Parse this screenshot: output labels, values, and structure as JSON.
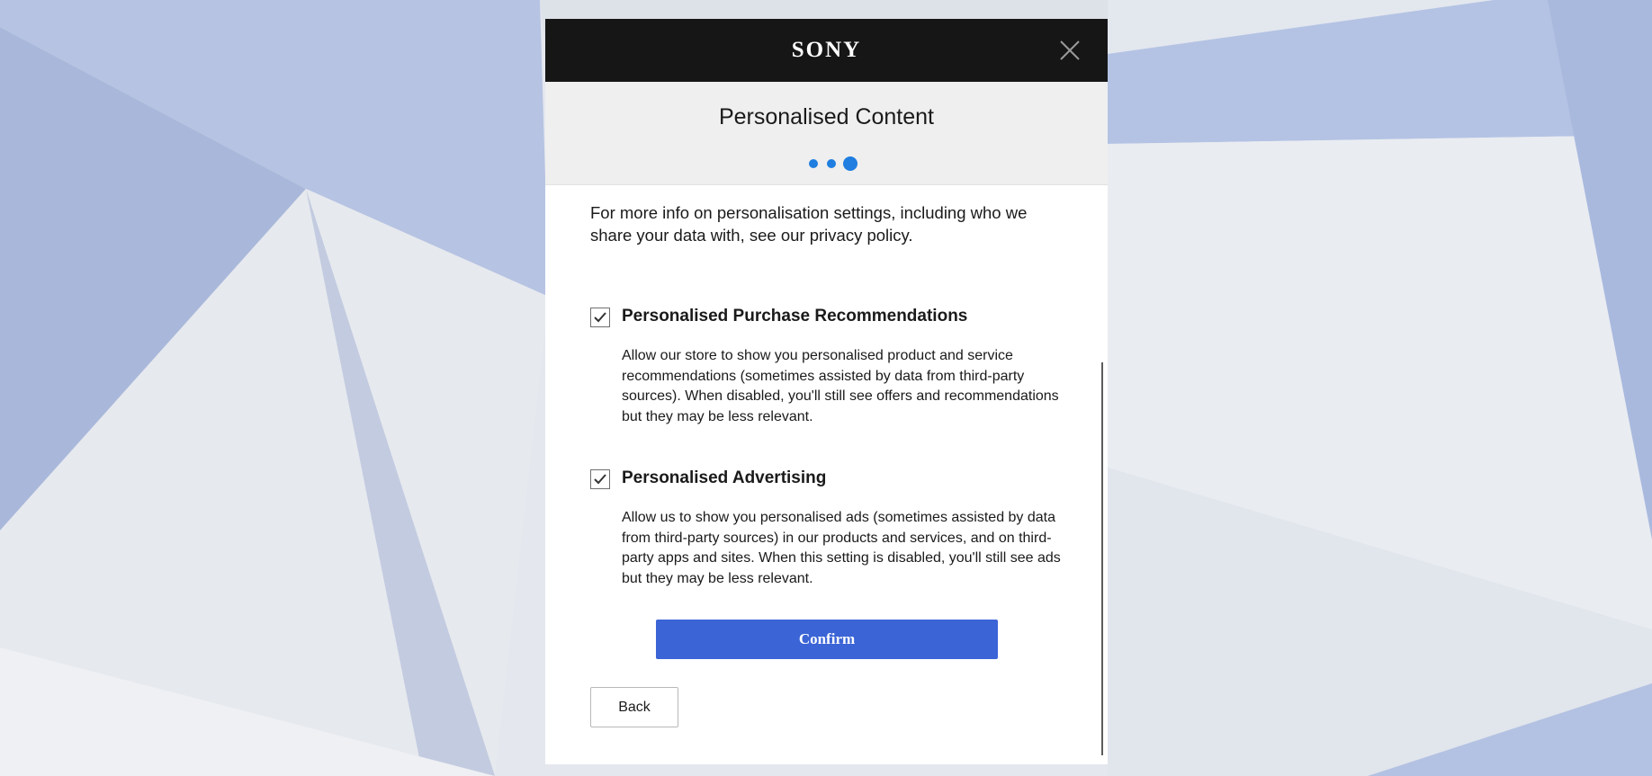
{
  "header": {
    "logo_text": "SONY",
    "close_icon": "close-icon",
    "background_color": "#161616"
  },
  "title_area": {
    "title": "Personalised Content",
    "progress": {
      "total_steps": 3,
      "current_step": 3,
      "color": "#1f7ee0"
    }
  },
  "content": {
    "intro": "For more info on personalisation settings, including who we share your data with, see our privacy policy.",
    "options": [
      {
        "title": "Personalised Purchase Recommendations",
        "checked": true,
        "description": "Allow our store to show you personalised product and service recommendations (sometimes assisted by data from third-party sources). When disabled, you'll still see offers and recommendations but they may be less relevant."
      },
      {
        "title": "Personalised Advertising",
        "checked": true,
        "description": "Allow us to show you personalised ads (sometimes assisted by data from third-party sources) in our products and services, and on third-party apps and sites. When this setting is disabled, you'll still see ads but they may be less relevant."
      }
    ],
    "confirm_label": "Confirm",
    "back_label": "Back"
  },
  "colors": {
    "confirm_button": "#3b64d6",
    "accent": "#1f7ee0"
  }
}
